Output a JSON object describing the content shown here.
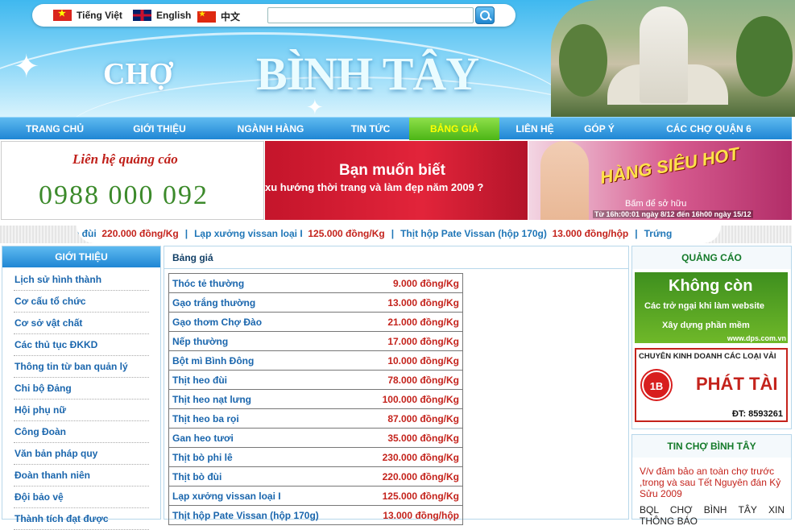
{
  "languages": [
    {
      "label": "Tiếng Việt",
      "icon": "vietnam-flag-icon"
    },
    {
      "label": "English",
      "icon": "uk-flag-icon"
    },
    {
      "label": "中文",
      "icon": "china-flag-icon"
    }
  ],
  "search": {
    "value": "",
    "icon": "search-icon"
  },
  "logo": {
    "prefix": "CHỢ",
    "name": "BÌNH TÂY"
  },
  "nav": [
    {
      "label": "TRANG CHỦ"
    },
    {
      "label": "GIỚI THIỆU"
    },
    {
      "label": "NGÀNH HÀNG"
    },
    {
      "label": "TIN TỨC"
    },
    {
      "label": "BẢNG GIÁ",
      "active": true
    },
    {
      "label": "LIÊN HỆ"
    },
    {
      "label": "GÓP Ý"
    },
    {
      "label": "CÁC CHỢ QUẬN 6"
    }
  ],
  "ads": {
    "contact_title": "Liên hệ quảng cáo",
    "contact_phone": "0988 000 092",
    "fashion_line1": "Bạn muốn biết",
    "fashion_line2": "xu hướng thời trang và làm đẹp năm 2009 ?",
    "hot_title": "HÀNG SIÊU HOT",
    "hot_buy": "Bấm để sở hữu",
    "hot_time": "Từ 16h:00:01 ngày 8/12 đến 16h00 ngày 15/12"
  },
  "ticker": {
    "items": [
      {
        "name": "ò đùi",
        "price": "220.000 đồng/Kg"
      },
      {
        "name": "Lạp xưởng vissan loại I",
        "price": "125.000 đồng/Kg"
      },
      {
        "name": "Thịt hộp Pate Vissan (hộp 170g)",
        "price": "13.000 đồng/hộp"
      },
      {
        "name": "Trứng",
        "price": ""
      }
    ],
    "separator": "|"
  },
  "sidebar": {
    "title": "GIỚI THIỆU",
    "items": [
      "Lịch sử hình thành",
      "Cơ cấu tổ chức",
      "Cơ sở vật chất",
      "Các thủ tục ĐKKD",
      "Thông tin từ ban quản lý",
      "Chi bộ Đảng",
      "Hội phụ nữ",
      "Công Đoàn",
      "Văn bản pháp quy",
      "Đoàn thanh niên",
      "Đội bảo vệ",
      "Thành tích đạt được"
    ]
  },
  "prices": {
    "title": "Bảng giá",
    "rows": [
      {
        "name": "Thóc tẻ thường",
        "price": "9.000 đồng/Kg"
      },
      {
        "name": "Gạo trắng thường",
        "price": "13.000 đồng/Kg"
      },
      {
        "name": "Gạo thơm Chợ Đào",
        "price": "21.000 đồng/Kg"
      },
      {
        "name": "Nếp thường",
        "price": "17.000 đồng/Kg"
      },
      {
        "name": "Bột mì Bình Đông",
        "price": "10.000 đồng/Kg"
      },
      {
        "name": "Thịt heo đùi",
        "price": "78.000 đồng/Kg"
      },
      {
        "name": "Thịt heo nạt lưng",
        "price": "100.000 đồng/Kg"
      },
      {
        "name": "Thịt heo ba rọi",
        "price": "87.000 đồng/Kg"
      },
      {
        "name": "Gan heo tươi",
        "price": "35.000 đồng/Kg"
      },
      {
        "name": "Thịt bò phi lê",
        "price": "230.000 đồng/Kg"
      },
      {
        "name": "Thịt bò đùi",
        "price": "220.000 đồng/Kg"
      },
      {
        "name": "Lạp xưởng vissan loại I",
        "price": "125.000 đồng/Kg"
      },
      {
        "name": "Thịt hộp Pate Vissan (hộp 170g)",
        "price": "13.000 đồng/hộp"
      }
    ]
  },
  "right": {
    "ads_title": "QUẢNG CÁO",
    "dps_big": "Không còn",
    "dps_line1": "Các trở ngại khi làm website",
    "dps_line2": "Xây dựng phần mềm",
    "dps_url": "www.dps.com.vn",
    "vai_header": "CHUYÊN KINH DOANH CÁC LOẠI VẢI",
    "vai_logo": "1B",
    "vai_name": "PHÁT TÀI",
    "vai_phone": "ĐT: 8593261",
    "news_title": "TIN CHỢ BÌNH TÂY",
    "news_item1": "V/v đảm bảo an toàn chợ trước ,trong và sau Tết Nguyên đán Kỷ Sửu 2009",
    "news_item2": "BQL CHỢ BÌNH TÂY XIN THÔNG BÁO"
  },
  "colors": {
    "accent": "#1f86d4",
    "active_tab": "#4cb516",
    "price": "#c4231c",
    "link": "#1a66ad"
  }
}
